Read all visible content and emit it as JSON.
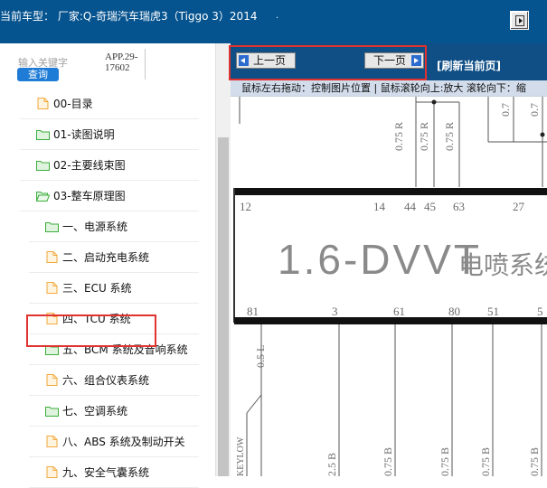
{
  "topbar": {
    "title": "当前车型：  厂家:Q-奇瑞汽车瑞虎3（Tiggo 3）2014",
    "dot": ".",
    "toggle_icon": "panel-toggle-icon"
  },
  "search": {
    "label": "输入关键字",
    "app_code": "APP.29-\n17602",
    "button_label": "查询"
  },
  "tree": {
    "items": [
      {
        "label": "00-目录",
        "icon": "file-icon"
      },
      {
        "label": "01-读图说明",
        "icon": "folder-icon"
      },
      {
        "label": "02-主要线束图",
        "icon": "folder-icon"
      },
      {
        "label": "03-整车原理图",
        "icon": "folder-open-icon"
      },
      {
        "label": "一、电源系统",
        "icon": "folder-icon"
      },
      {
        "label": "二、启动充电系统",
        "icon": "file-icon"
      },
      {
        "label": "三、ECU 系统",
        "icon": "file-icon"
      },
      {
        "label": "四、TCU 系统",
        "icon": "file-icon"
      },
      {
        "label": "五、BCM 系统及音响系统",
        "icon": "folder-icon"
      },
      {
        "label": "六、组合仪表系统",
        "icon": "file-icon"
      },
      {
        "label": "七、空调系统",
        "icon": "folder-icon"
      },
      {
        "label": "八、ABS 系统及制动开关",
        "icon": "file-icon"
      },
      {
        "label": "九、安全气囊系统",
        "icon": "file-icon"
      }
    ]
  },
  "viewer": {
    "prev_label": "上一页",
    "next_label": "下一页",
    "refresh_label": "[刷新当前页]",
    "hint": "鼠标左右拖动：控制图片位置 | 鼠标滚轮向上:放大  滚轮向下：缩",
    "diagram": {
      "heading": "1.6-DVVT",
      "heading_suffix": "电喷系统",
      "top_pins": [
        "12",
        "14",
        "44",
        "45",
        "63",
        "27"
      ],
      "bottom_pins": [
        "81",
        "3",
        "61",
        "80",
        "51",
        "5"
      ],
      "upper_wires": [
        "0.75 R",
        "0.75 R",
        "0.75 R",
        "0.7"
      ],
      "lower_wires": [
        "0.5 L",
        "2.5 B",
        "0.75 B",
        "0.75 B",
        "0.75 B",
        "0.75 B"
      ],
      "side_label": "KEYLOW"
    }
  },
  "colors": {
    "topbar": "#05538f",
    "navbar": "#0f4f86",
    "highlight": "#e0322f",
    "folder": "#3cae3c",
    "file": "#f2a93b"
  }
}
